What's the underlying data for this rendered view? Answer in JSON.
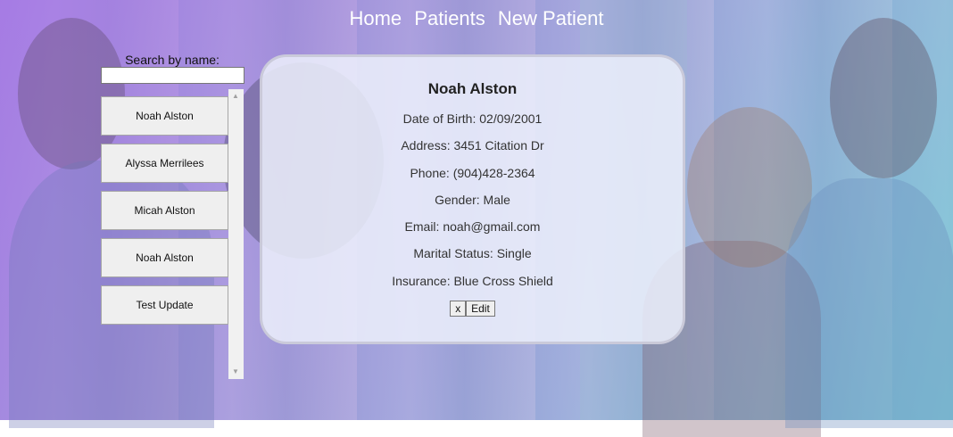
{
  "nav": {
    "home": "Home",
    "patients": "Patients",
    "new_patient": "New Patient"
  },
  "search": {
    "label": "Search by name:",
    "value": ""
  },
  "patients": [
    "Noah Alston",
    "Alyssa Merrilees",
    "Micah Alston",
    "Noah Alston",
    "Test Update"
  ],
  "detail": {
    "name": "Noah Alston",
    "dob": "Date of Birth: 02/09/2001",
    "address": "Address: 3451 Citation Dr",
    "phone": "Phone: (904)428-2364",
    "gender": "Gender: Male",
    "email": "Email: noah@gmail.com",
    "marital": "Marital Status: Single",
    "insurance": "Insurance: Blue Cross Shield",
    "close_label": "x",
    "edit_label": "Edit"
  }
}
